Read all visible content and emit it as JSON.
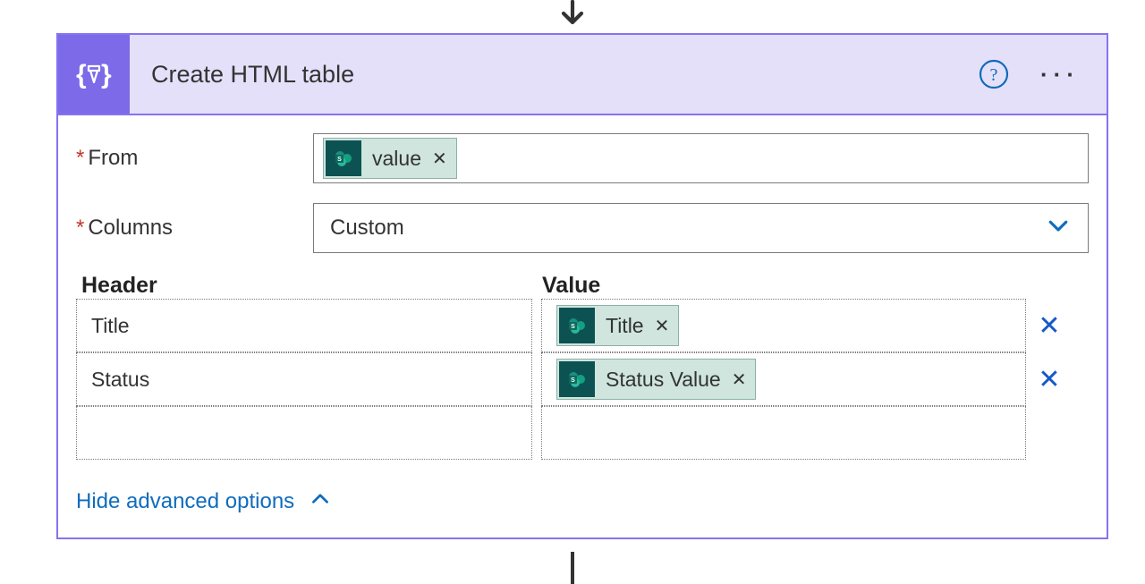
{
  "action": {
    "title": "Create HTML table"
  },
  "fields": {
    "from": {
      "label": "From",
      "required": true,
      "token": {
        "label": "value"
      }
    },
    "columns": {
      "label": "Columns",
      "required": true,
      "selected": "Custom"
    }
  },
  "columnsTable": {
    "headers": {
      "header": "Header",
      "value": "Value"
    },
    "rows": [
      {
        "header": "Title",
        "value_token": "Title"
      },
      {
        "header": "Status",
        "value_token": "Status Value"
      },
      {
        "header": "",
        "value_token": ""
      }
    ]
  },
  "footer": {
    "toggle": "Hide advanced options"
  }
}
